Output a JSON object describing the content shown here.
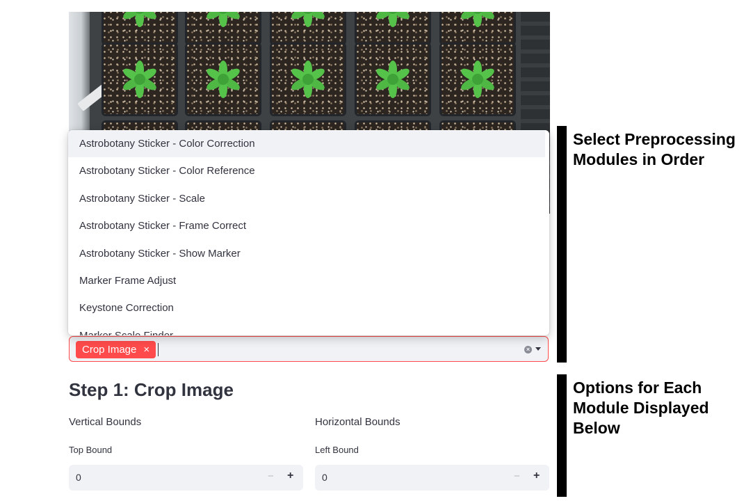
{
  "preprocessing": {
    "options": [
      "Astrobotany Sticker - Color Correction",
      "Astrobotany Sticker - Color Reference",
      "Astrobotany Sticker - Scale",
      "Astrobotany Sticker - Frame Correct",
      "Astrobotany Sticker - Show Marker",
      "Marker Frame Adjust",
      "Keystone Correction",
      "Marker Scale Finder"
    ],
    "highlighted_option": "Astrobotany Sticker - Color Correction",
    "selected_tags": [
      "Crop Image"
    ],
    "tag_close_symbol": "×",
    "clear_symbol": "×"
  },
  "annotations": {
    "top": "Select Preprocessing Modules in Order",
    "bottom": "Options for Each Module Displayed Below"
  },
  "step": {
    "title": "Step 1: Crop Image",
    "vertical": {
      "heading": "Vertical Bounds",
      "field_label": "Top Bound",
      "value": "0"
    },
    "horizontal": {
      "heading": "Horizontal Bounds",
      "field_label": "Left Bound",
      "value": "0"
    },
    "minus_symbol": "−",
    "plus_symbol": "+"
  },
  "colors": {
    "accent": "#ff4b4b",
    "input_background": "#f0f2f6",
    "text": "#31333f",
    "plant_green": "#55c24a"
  }
}
